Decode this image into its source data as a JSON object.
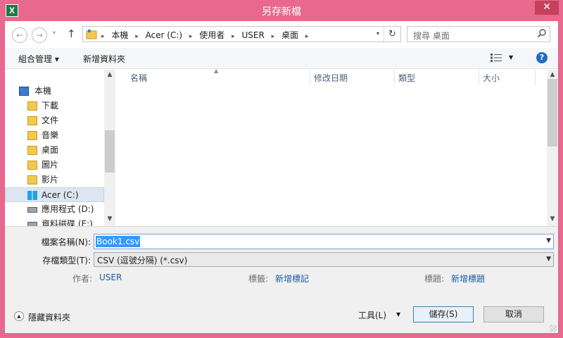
{
  "window": {
    "title": "另存新檔",
    "app_icon_letter": "X",
    "close_glyph": "✕"
  },
  "nav": {
    "back_glyph": "←",
    "forward_glyph": "→",
    "up_glyph": "↑",
    "breadcrumbs": [
      "本機",
      "Acer (C:)",
      "使用者",
      "USER",
      "桌面"
    ],
    "refresh_glyph": "↻"
  },
  "search": {
    "placeholder": "搜尋 桌面"
  },
  "toolbar": {
    "organize": "組合管理 ▾",
    "new_folder": "新增資料夾"
  },
  "tree": {
    "items": [
      {
        "label": "本機",
        "icon": "computer-icon"
      },
      {
        "label": "下載",
        "icon": "downloads-folder-icon"
      },
      {
        "label": "文件",
        "icon": "documents-folder-icon"
      },
      {
        "label": "音樂",
        "icon": "music-folder-icon"
      },
      {
        "label": "桌面",
        "icon": "desktop-folder-icon"
      },
      {
        "label": "圖片",
        "icon": "pictures-folder-icon"
      },
      {
        "label": "影片",
        "icon": "videos-folder-icon"
      },
      {
        "label": "Acer (C:)",
        "icon": "windows-drive-icon",
        "selected": true
      },
      {
        "label": "應用程式 (D:)",
        "icon": "drive-icon"
      },
      {
        "label": "資料磁碟 (E:)",
        "icon": "drive-icon"
      }
    ]
  },
  "list": {
    "columns": [
      "名稱",
      "修改日期",
      "類型",
      "大小"
    ]
  },
  "form": {
    "filename_label": "檔案名稱(N):",
    "filename_value": "Book1.csv",
    "filetype_label": "存檔類型(T):",
    "filetype_value": "CSV (逗號分隔) (*.csv)",
    "authors_label": "作者:",
    "authors_value": "USER",
    "tags_label": "標籤:",
    "tags_value": "新增標記",
    "title_label": "標題:",
    "title_value": "新增標題"
  },
  "footer": {
    "hide_folders": "隱藏資料夾",
    "tools": "工具(L)",
    "save": "儲存(S)",
    "cancel": "取消"
  }
}
